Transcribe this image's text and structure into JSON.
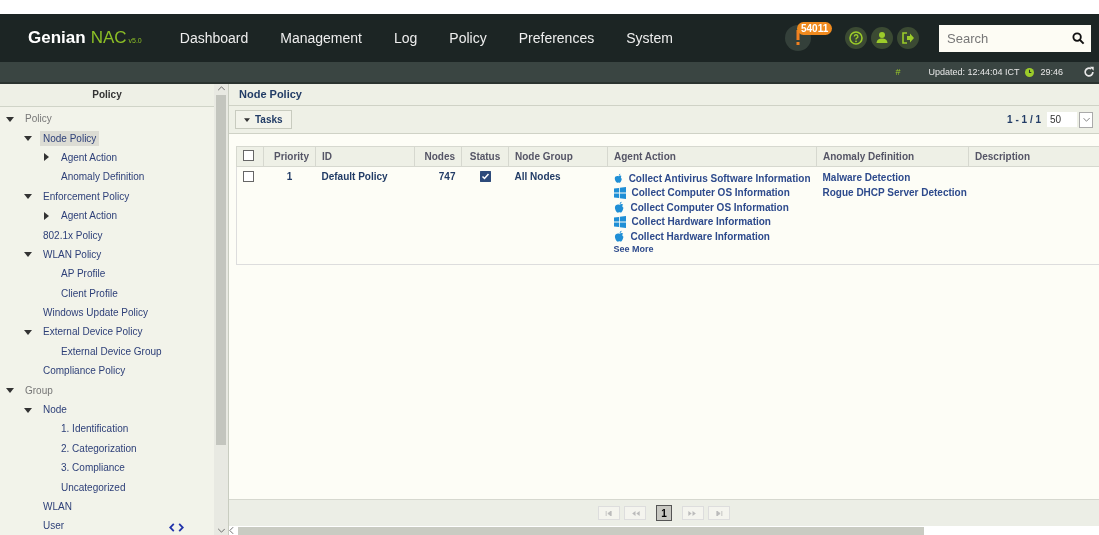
{
  "header": {
    "brand": "Genian",
    "brand_accent": "NAC",
    "version": "v5.0",
    "nav": [
      {
        "label": "Dashboard",
        "selected": false
      },
      {
        "label": "Management",
        "selected": false
      },
      {
        "label": "Log",
        "selected": false
      },
      {
        "label": "Policy",
        "selected": false
      },
      {
        "label": "Preferences",
        "selected": false
      },
      {
        "label": "System",
        "selected": false
      }
    ],
    "alert_count": "54011",
    "search": {
      "placeholder": "Search"
    }
  },
  "status_bar": {
    "hash": "#",
    "updated": "Updated: 12:44:04 ICT",
    "timer": "29:46"
  },
  "sidebar": {
    "title": "Policy",
    "items": [
      {
        "label": "Policy",
        "expanded": true,
        "selected": false,
        "children": [
          {
            "label": "Node Policy",
            "expanded": true,
            "selected": true,
            "children": [
              {
                "label": "Agent Action",
                "expanded": false,
                "selected": false
              },
              {
                "label": "Anomaly Definition",
                "selected": false
              }
            ]
          },
          {
            "label": "Enforcement Policy",
            "expanded": true,
            "selected": false,
            "children": [
              {
                "label": "Agent Action",
                "expanded": false,
                "selected": false
              }
            ]
          },
          {
            "label": "802.1x Policy",
            "selected": false
          },
          {
            "label": "WLAN Policy",
            "expanded": true,
            "selected": false,
            "children": [
              {
                "label": "AP Profile",
                "selected": false
              },
              {
                "label": "Client Profile",
                "selected": false
              }
            ]
          },
          {
            "label": "Windows Update Policy",
            "selected": false
          },
          {
            "label": "External Device Policy",
            "expanded": true,
            "selected": false,
            "children": [
              {
                "label": "External Device Group",
                "selected": false
              }
            ]
          },
          {
            "label": "Compliance Policy",
            "selected": false
          }
        ]
      },
      {
        "label": "Group",
        "expanded": true,
        "selected": false,
        "children": [
          {
            "label": "Node",
            "expanded": true,
            "selected": false,
            "children": [
              {
                "label": "1. Identification",
                "selected": false
              },
              {
                "label": "2. Categorization",
                "selected": false
              },
              {
                "label": "3. Compliance",
                "selected": false
              },
              {
                "label": "Uncategorized",
                "selected": false
              }
            ]
          },
          {
            "label": "WLAN",
            "selected": false
          },
          {
            "label": "User",
            "selected": false
          }
        ]
      }
    ]
  },
  "main": {
    "title": "Node Policy",
    "tasks_button": "Tasks",
    "range": "1 - 1 / 1",
    "page_size": "50",
    "table": {
      "all_checked": false,
      "columns": [
        "Priority",
        "ID",
        "Nodes",
        "Status",
        "Node Group",
        "Agent Action",
        "Anomaly Definition",
        "Description"
      ],
      "rows": [
        {
          "checked": false,
          "priority": "1",
          "id": "Default Policy",
          "nodes": "747",
          "status": true,
          "node_group": "All Nodes",
          "agent_actions": [
            {
              "kind": "apple",
              "label": "Collect Antivirus Software Information"
            },
            {
              "kind": "windows",
              "label": "Collect Computer OS Information"
            },
            {
              "kind": "apple",
              "label": "Collect Computer OS Information"
            },
            {
              "kind": "windows",
              "label": "Collect Hardware Information"
            },
            {
              "kind": "apple",
              "label": "Collect Hardware Information"
            }
          ],
          "see_more": "See More",
          "anomalies": [
            "Malware Detection",
            "Rogue DHCP Server Detection"
          ]
        }
      ]
    },
    "pager": {
      "pages": [
        {
          "label": "1",
          "selected": true
        }
      ]
    }
  }
}
